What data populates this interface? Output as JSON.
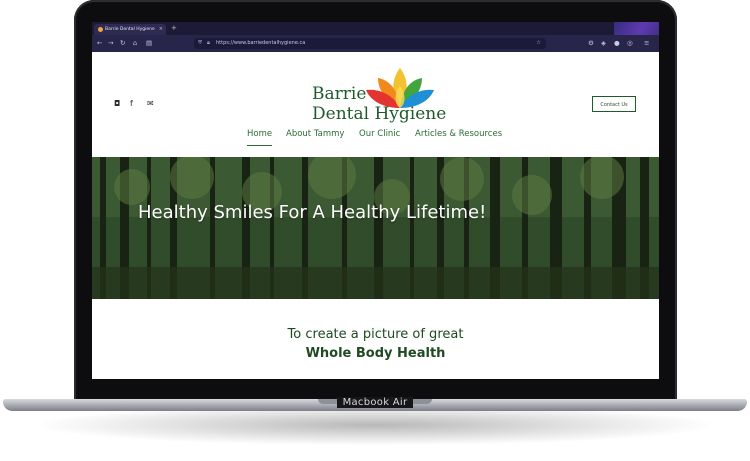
{
  "device": {
    "label": "Macbook Air"
  },
  "browser": {
    "tab_title": "Barrie Dental Hygiene",
    "tab_close": "×",
    "new_tab": "+",
    "url": "https://www.barriedentalhygiene.ca",
    "icons": [
      "back-icon",
      "forward-icon",
      "reload-icon",
      "home-icon",
      "shield-icon",
      "lock-icon",
      "star-icon",
      "extensions-icon",
      "account-icon",
      "menu-icon"
    ]
  },
  "site": {
    "logo_line1": "Barrie",
    "logo_line2": "Dental Hygiene",
    "contact_label": "Contact Us",
    "nav": [
      "Home",
      "About Tammy",
      "Our Clinic",
      "Articles & Resources"
    ],
    "hero_title": "Healthy Smiles For A Healthy Lifetime!",
    "mission_line1": "To create a picture of great",
    "mission_line2": "Whole Body Health",
    "social_icons": [
      "instagram-icon",
      "facebook-icon",
      "email-icon"
    ],
    "colors": {
      "brand_green": "#1f5a2b",
      "nav_green": "#2d6a38",
      "browser_bg": "#27254a"
    }
  }
}
